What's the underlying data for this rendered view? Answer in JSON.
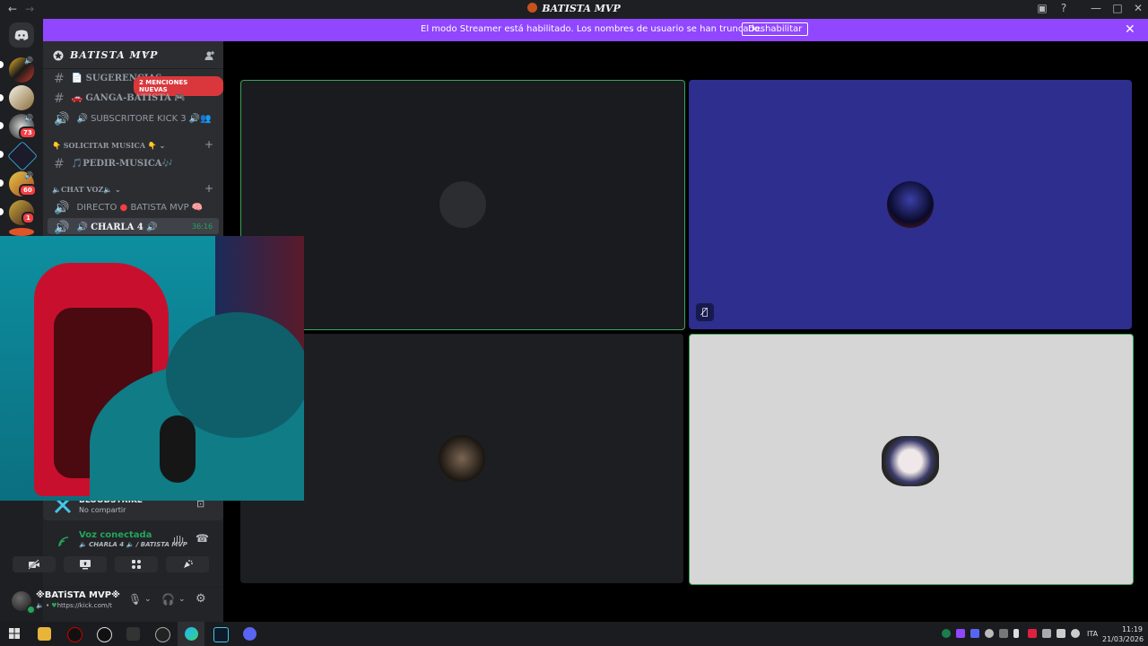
{
  "window": {
    "title": "BATISTA MVP",
    "back_icon": "arrow-left-icon",
    "forward_icon": "arrow-right-icon",
    "help_icon": "help-icon",
    "minimize": "—",
    "maximize": "□",
    "close": "✕"
  },
  "banner": {
    "message": "El modo Streamer está habilitado. Los nombres de usuario se han truncado.",
    "button": "Deshabilitar",
    "close": "✕"
  },
  "servers": {
    "badges": [
      "73",
      "60",
      "1"
    ]
  },
  "server": {
    "name": "BATISTA MVP",
    "chevron": "⌄"
  },
  "channels": {
    "sugerencias": "SUGERENCIAS",
    "ganga": "GANGA-BATISTA",
    "subscritore": "SUBSCRITORE KICK 3",
    "mentions": "2 MENCIONES NUEVAS",
    "cat_musica": "SOLICITAR MUSICA",
    "pedir": "PEDIR-MUSICA",
    "cat_voz": "CHAT VOZ",
    "directo_a": "DIRECTO",
    "directo_b": "BATISTA MVP",
    "charla": "CHARLA 4",
    "charla_time": "36:16"
  },
  "panel": {
    "stream_user": "BLOODSTRIKE",
    "stream_status": "No compartir",
    "voice_status": "Voz conectada",
    "voice_channel": "CHARLA 4",
    "voice_server": "BATISTA MVP",
    "user_name": "BATiSTA MVP",
    "user_status": "https://kick.com/t"
  },
  "taskbar": {
    "lang": "ITA",
    "time": "11:19",
    "date": "21/03/2026"
  },
  "colors": {
    "accent": "#9146ff",
    "speaking": "#3ba55c",
    "blue_tile": "#2d2e8d",
    "grey_tile": "#d6d6d6"
  }
}
